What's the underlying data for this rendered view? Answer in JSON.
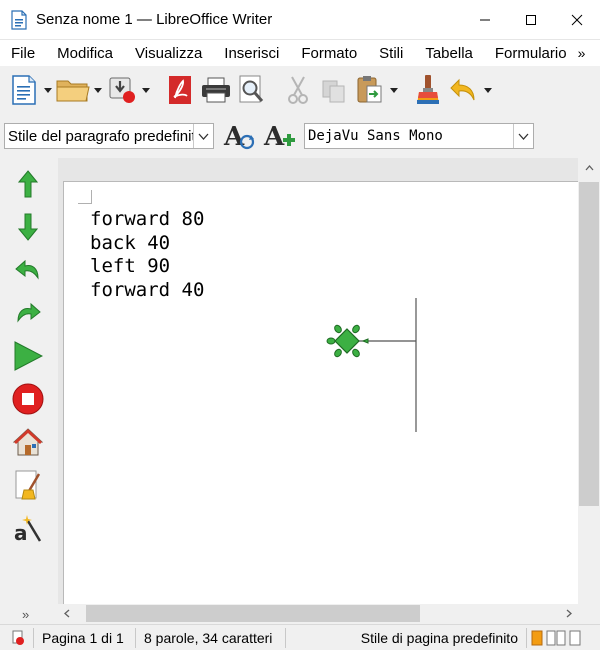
{
  "window": {
    "title": "Senza nome 1 — LibreOffice Writer"
  },
  "menubar": {
    "items": [
      "File",
      "Modifica",
      "Visualizza",
      "Inserisci",
      "Formato",
      "Stili",
      "Tabella",
      "Formulario"
    ],
    "more": "»"
  },
  "toolbar": {
    "paragraph_style": "Stile del paragrafo predefinito",
    "font_name": "DejaVu Sans Mono"
  },
  "document": {
    "lines": [
      "forward 80",
      "back 40",
      "left 90",
      "forward 40"
    ]
  },
  "sidebar": {
    "more": "»"
  },
  "statusbar": {
    "page": "Pagina 1 di 1",
    "words": "8 parole, 34 caratteri",
    "page_style": "Stile di pagina predefinito"
  },
  "colors": {
    "turtle_green": "#4caf50",
    "accent_red": "#e02020"
  }
}
